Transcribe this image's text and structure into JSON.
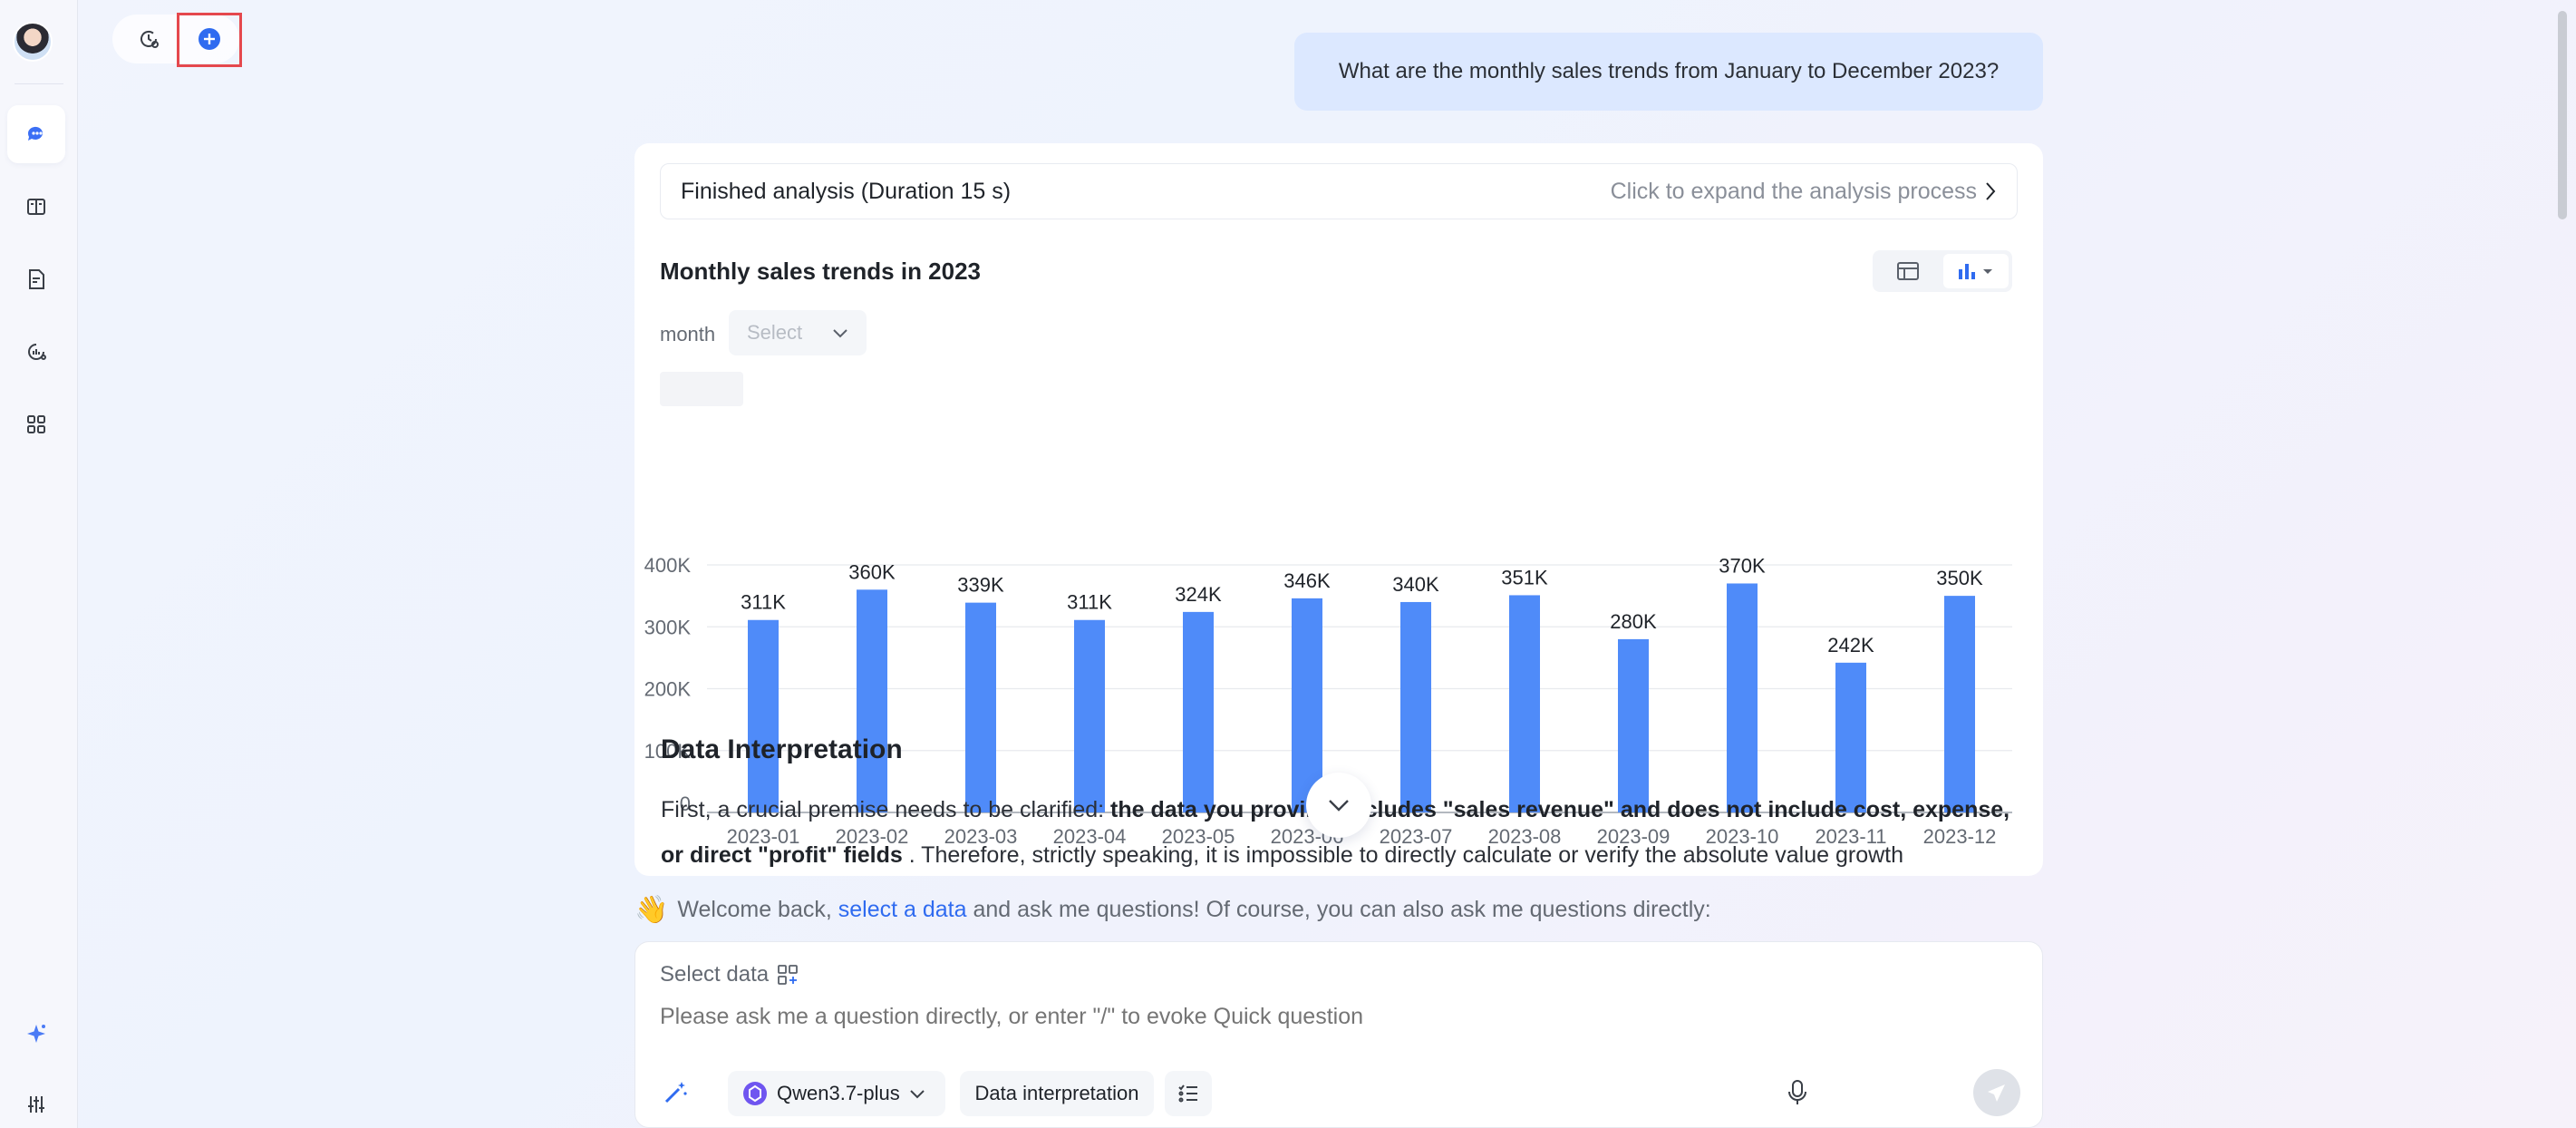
{
  "rail": {
    "items": [
      {
        "icon": "chat-icon",
        "active": true
      },
      {
        "icon": "book-icon",
        "active": false
      },
      {
        "icon": "report-icon",
        "active": false
      },
      {
        "icon": "analysis-icon",
        "active": false
      },
      {
        "icon": "apps-icon",
        "active": false
      }
    ],
    "bottom": [
      {
        "icon": "sparkle-icon"
      },
      {
        "icon": "settings-sliders-icon"
      }
    ]
  },
  "topbar": {
    "history_icon": "history-icon",
    "new_chat_icon": "new-chat-plus-icon"
  },
  "question": "What are the monthly sales trends from January to December 2023?",
  "analysis": {
    "status": "Finished analysis (Duration 15 s)",
    "expand": "Click to expand the analysis process"
  },
  "chart": {
    "title": "Monthly sales trends in 2023",
    "filter_label": "month",
    "filter_placeholder": "Select"
  },
  "chart_data": {
    "type": "bar",
    "title": "Monthly sales trends in 2023",
    "categories": [
      "2023-01",
      "2023-02",
      "2023-03",
      "2023-04",
      "2023-05",
      "2023-06",
      "2023-07",
      "2023-08",
      "2023-09",
      "2023-10",
      "2023-11",
      "2023-12"
    ],
    "values": [
      311000,
      360000,
      339000,
      311000,
      324000,
      346000,
      340000,
      351000,
      280000,
      370000,
      242000,
      350000
    ],
    "value_labels": [
      "311K",
      "360K",
      "339K",
      "311K",
      "324K",
      "346K",
      "340K",
      "351K",
      "280K",
      "370K",
      "242K",
      "350K"
    ],
    "yticks": [
      0,
      100000,
      200000,
      300000,
      400000
    ],
    "ytick_labels": [
      "0",
      "100K",
      "200K",
      "300K",
      "400K"
    ],
    "ylim": [
      0,
      400000
    ],
    "color": "#4f8bf9",
    "grid": true
  },
  "interpretation": {
    "title": "Data Interpretation",
    "p1_a": "First, a crucial premise needs to be clarified: ",
    "p1_bold": "the data you provi",
    "p1_bold2": "nly includes \"sales revenue\" and does not include cost, expense, or direct \"profit\" fields",
    "p1_b": " . Therefore, strictly speaking, it is impossible to directly calculate or verify the absolute value growth"
  },
  "welcome": {
    "wave": "👋",
    "pre": "Welcome back, ",
    "link": "select a data",
    "post": " and ask me questions! Of course, you can also ask me questions directly:"
  },
  "input": {
    "select_data": "Select data",
    "placeholder": "Please ask me a question directly, or enter \"/\" to evoke Quick question",
    "model": "Qwen3.7-plus",
    "mode": "Data interpretation"
  }
}
